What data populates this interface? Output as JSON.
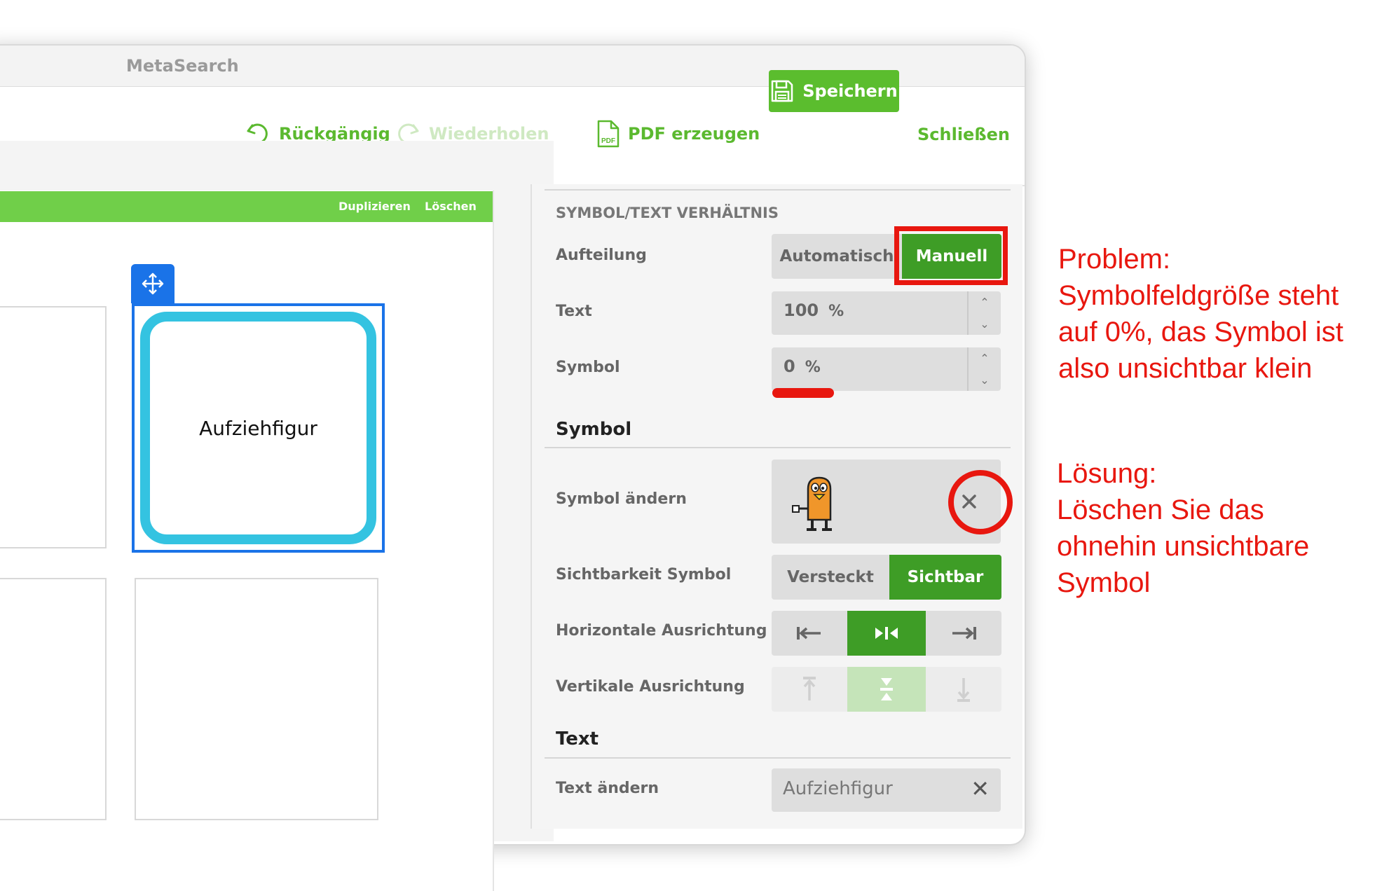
{
  "window": {
    "title": "MetaSearch"
  },
  "toolbar": {
    "undo_label": "Rückgängig",
    "redo_label": "Wiederholen",
    "pdf_label": "PDF erzeugen",
    "save_label": "Speichern",
    "close_label": "Schließen"
  },
  "editor": {
    "duplicate_label": "Duplizieren",
    "delete_label": "Löschen",
    "selected_cell_text": "Aufziehfigur"
  },
  "panel": {
    "ratio_section_title": "SYMBOL/TEXT VERHÄLTNIS",
    "split_label": "Aufteilung",
    "split_options": [
      "Automatisch",
      "Manuell"
    ],
    "split_selected": "Manuell",
    "text_label": "Text",
    "text_value": "100",
    "text_unit": "%",
    "symbol_label": "Symbol",
    "symbol_value": "0",
    "symbol_unit": "%",
    "symbol_section_title": "Symbol",
    "change_symbol_label": "Symbol ändern",
    "visibility_label": "Sichtbarkeit Symbol",
    "visibility_options": [
      "Versteckt",
      "Sichtbar"
    ],
    "visibility_selected": "Sichtbar",
    "horizontal_label": "Horizontale Ausrichtung",
    "horizontal_selected": "center",
    "vertical_label": "Vertikale Ausrichtung",
    "vertical_selected": "center",
    "text_section_title": "Text",
    "change_text_label": "Text ändern",
    "text_field_value": "Aufziehfigur"
  },
  "annotations": {
    "problem_lines": [
      "Problem:",
      "Symbolfeldgröße steht",
      "auf 0%, das Symbol ist",
      "also unsichtbar klein"
    ],
    "solution_lines": [
      "Lösung:",
      "Löschen Sie das",
      "ohnehin unsichtbare",
      "Symbol"
    ]
  },
  "colors": {
    "brand_green": "#5bbd2e",
    "active_green": "#3e9d26",
    "selection_blue": "#1a73e8",
    "cell_border_cyan": "#34c3e1",
    "annotation_red": "#e8170f"
  }
}
